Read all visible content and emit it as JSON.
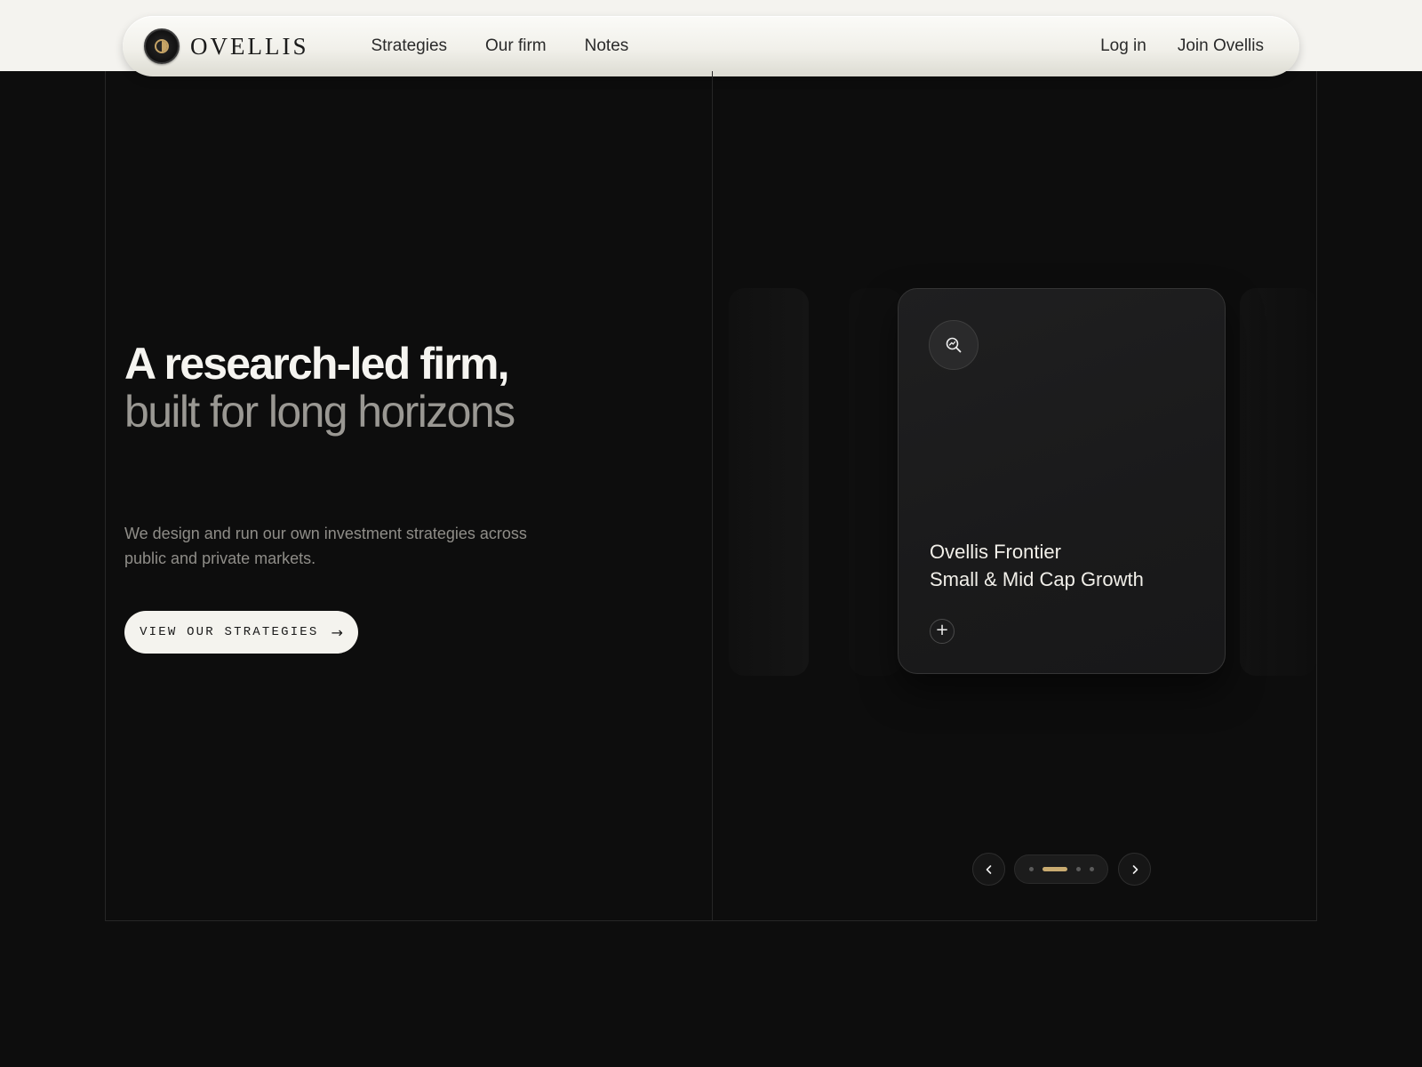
{
  "brand": {
    "name": "OVELLIS",
    "logo_icon": "ovellis-logo-icon"
  },
  "nav": {
    "links": [
      "Strategies",
      "Our firm",
      "Notes"
    ],
    "login": "Log in",
    "join": "Join Ovellis"
  },
  "hero": {
    "title_line1": "A research-led firm,",
    "title_line2": "built for long horizons",
    "description": "We design and run our own investment strategies across public and private markets.",
    "cta_label": "VIEW OUR STRATEGIES",
    "cta_icon": "arrow-right-icon"
  },
  "carousel": {
    "card": {
      "icon": "search-chart-icon",
      "title_line1": "Ovellis Frontier",
      "title_line2": "Small & Mid Cap Growth",
      "expand_icon": "plus-icon"
    },
    "prev_icon": "chevron-left-icon",
    "next_icon": "chevron-right-icon",
    "total_slides": 4,
    "active_slide": 2
  },
  "colors": {
    "background": "#0d0d0d",
    "header": "#f4f3ef",
    "accent": "#c9ab70"
  }
}
